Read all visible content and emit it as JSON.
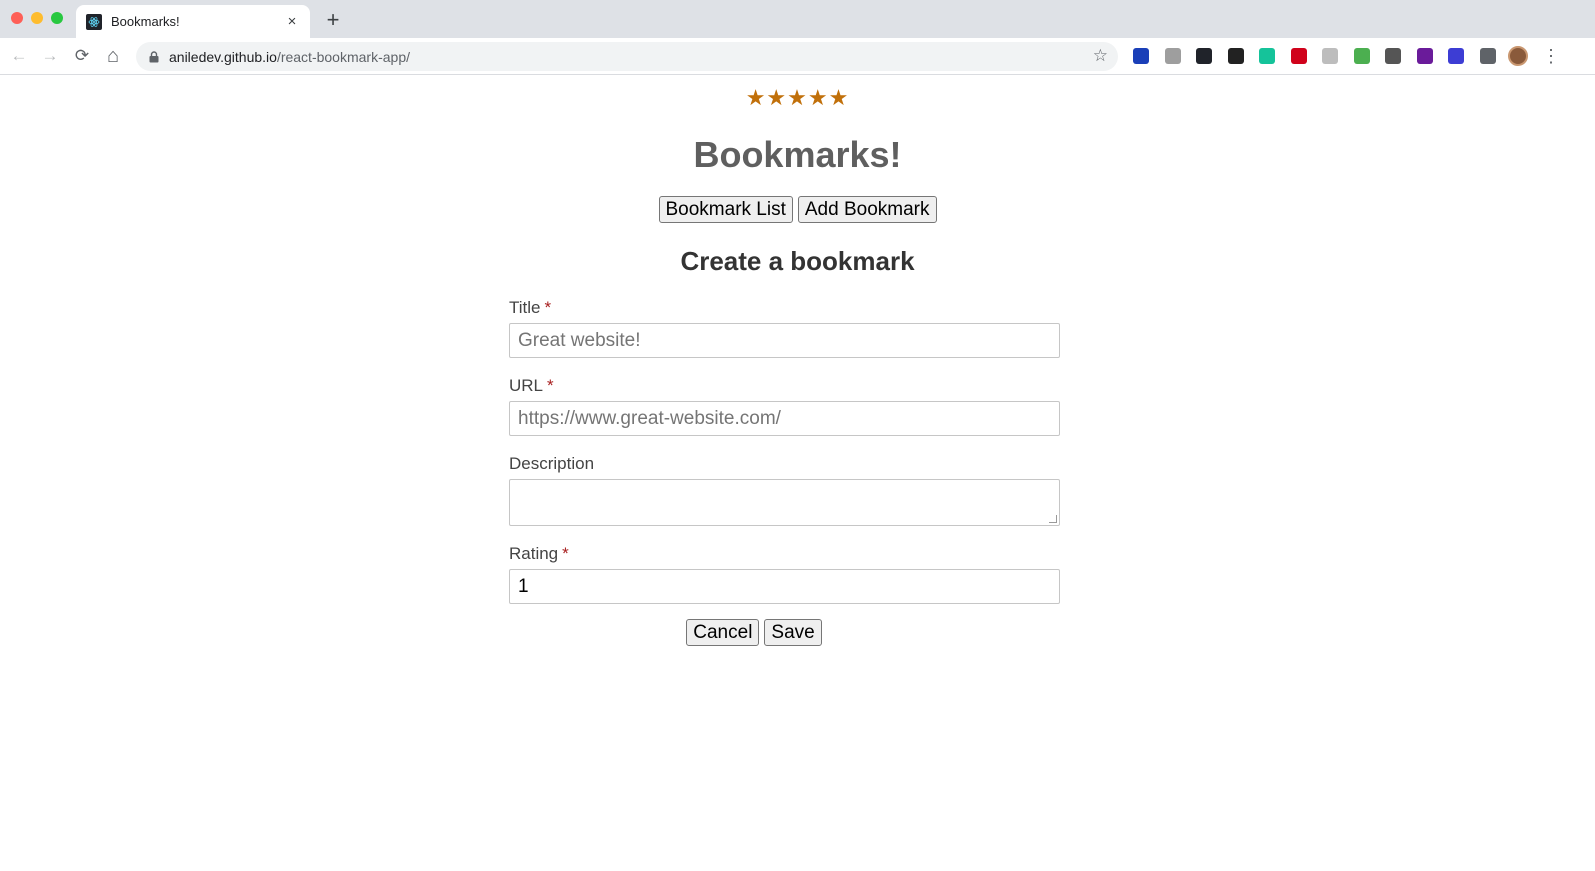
{
  "browser": {
    "tab_title": "Bookmarks!",
    "tab_close": "×",
    "new_tab": "+",
    "url_host": "aniledev.github.io",
    "url_path": "/react-bookmark-app/",
    "back": "←",
    "forward": "→",
    "reload": "⟳",
    "home": "⌂",
    "bookmark_star": "☆",
    "menu": "⋮",
    "extensions": [
      {
        "name": "vimeo-like-extension",
        "color": "#1a3fb8"
      },
      {
        "name": "pocket-extension",
        "color": "#9e9e9e"
      },
      {
        "name": "react-devtools-extension",
        "color": "#20232a"
      },
      {
        "name": "typography-extension",
        "color": "#222222"
      },
      {
        "name": "grammarly-extension",
        "color": "#15c39a"
      },
      {
        "name": "quora-extension",
        "color": "#d0021b"
      },
      {
        "name": "cool-extension",
        "color": "#bdbdbd"
      },
      {
        "name": "green-leaf-extension",
        "color": "#4caf50"
      },
      {
        "name": "list-extension",
        "color": "#555555"
      },
      {
        "name": "colorful-extension",
        "color": "#6a1b9a"
      },
      {
        "name": "info-extension",
        "color": "#3d3dd4"
      },
      {
        "name": "puzzle-extension",
        "color": "#5f6368"
      }
    ]
  },
  "page": {
    "stars": "★★★★★",
    "title": "Bookmarks!",
    "nav_buttons": {
      "list": "Bookmark List",
      "add": "Add Bookmark"
    },
    "form_heading": "Create a bookmark",
    "fields": {
      "title": {
        "label": "Title",
        "required_mark": "*",
        "placeholder": "Great website!",
        "value": ""
      },
      "url": {
        "label": "URL",
        "required_mark": "*",
        "placeholder": "https://www.great-website.com/",
        "value": ""
      },
      "description": {
        "label": "Description",
        "value": ""
      },
      "rating": {
        "label": "Rating",
        "required_mark": "*",
        "value": "1"
      }
    },
    "actions": {
      "cancel": "Cancel",
      "save": "Save"
    }
  },
  "colors": {
    "star": "#c1700a",
    "title": "#5f5f5f",
    "required": "#a71e1e"
  }
}
